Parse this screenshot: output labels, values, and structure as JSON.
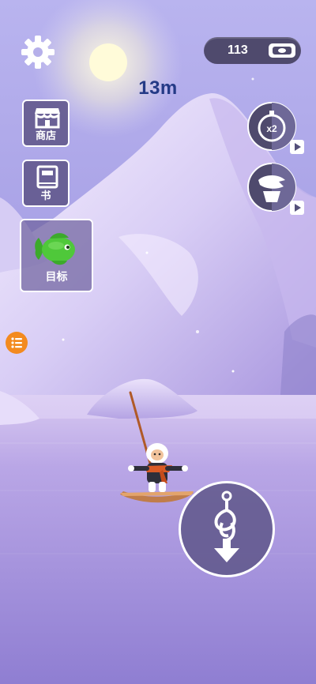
{
  "hud": {
    "coins": "113",
    "depth": "13m",
    "multiplier_label": "x2"
  },
  "sidebar": {
    "shop_label": "商店",
    "book_label": "书",
    "goal_label": "目标"
  },
  "icons": {
    "settings": "gear-icon",
    "coins": "cash-icon",
    "shop": "storefront-icon",
    "book": "book-icon",
    "goal": "fish-icon",
    "speed_boost": "stopwatch-icon",
    "bait_boost": "bait-icon",
    "list": "list-icon",
    "drop": "anchor-rope-arrow-icon"
  },
  "colors": {
    "sky": "#b9b4ef",
    "depth_text": "#243a86",
    "pill_bg": "#4f4a6d",
    "button_bg": "#60578a",
    "accent_orange": "#f38a1f",
    "fish_green": "#4fc83a"
  }
}
